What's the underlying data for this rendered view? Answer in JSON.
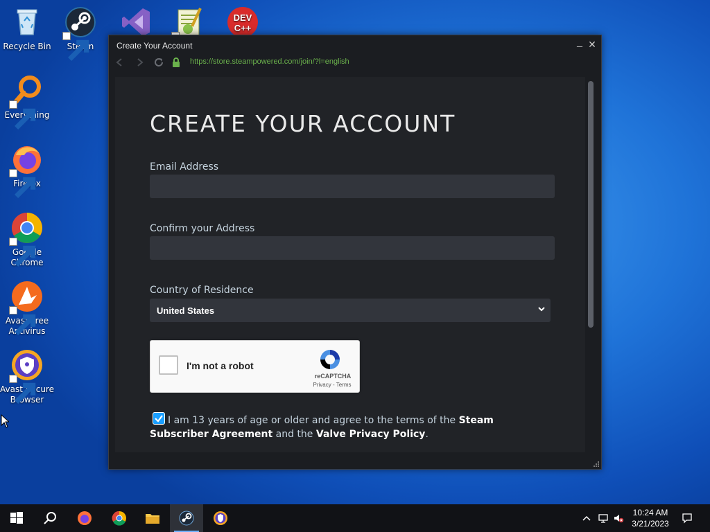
{
  "desktop": {
    "icons": [
      {
        "label": "Recycle Bin"
      },
      {
        "label": "Steam"
      },
      {
        "label": "Everything"
      },
      {
        "label": "Firefox"
      },
      {
        "label": "Google Chrome"
      },
      {
        "label": "Avast Free Antivirus"
      },
      {
        "label": "Avast Secure Browser"
      }
    ]
  },
  "window": {
    "title": "Create Your Account",
    "minimize_glyph": "_",
    "close_glyph": "✕",
    "url": "https://store.steampowered.com/join/?l=english"
  },
  "form": {
    "heading": "CREATE YOUR ACCOUNT",
    "email_label": "Email Address",
    "email_value": "",
    "confirm_label": "Confirm your Address",
    "confirm_value": "",
    "country_label": "Country of Residence",
    "country_value": "United States",
    "captcha": {
      "label": "I'm not a robot",
      "brand": "reCAPTCHA",
      "links": "Privacy - Terms"
    },
    "agreement": {
      "checked": true,
      "text_1": "I am 13 years of age or older and agree to the terms of the ",
      "link_1": "Steam Subscriber Agreement",
      "text_2": " and the ",
      "link_2": "Valve Privacy Policy",
      "text_3": "."
    }
  },
  "taskbar": {
    "time": "10:24 AM",
    "date": "3/21/2023"
  },
  "colors": {
    "accent": "#1a9fff",
    "url_green": "#6bb24c",
    "panel": "#212327",
    "field": "#32353c"
  }
}
